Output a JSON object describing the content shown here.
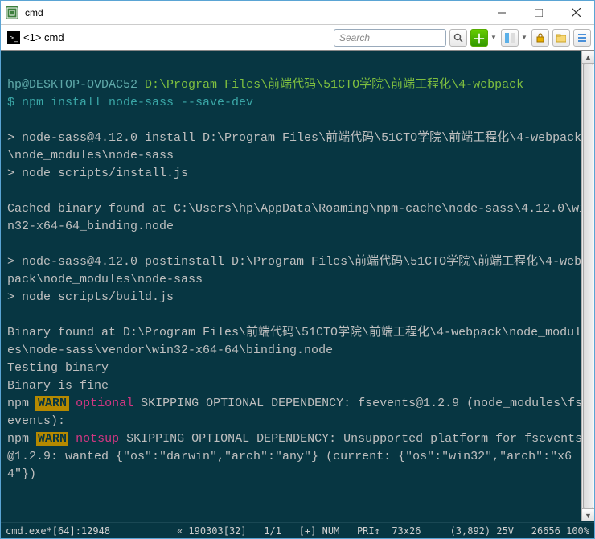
{
  "titlebar": {
    "title": "cmd"
  },
  "tabs": [
    {
      "label": "<1> cmd"
    }
  ],
  "toolbar": {
    "search_placeholder": "Search"
  },
  "terminal": {
    "prompt_user": "hp@DESKTOP-OVDAC52",
    "prompt_path": "D:\\Program Files\\前端代码\\51CTO学院\\前端工程化\\4-webpack",
    "command": "$ npm install node-sass --save-dev",
    "lines": [
      "> node-sass@4.12.0 install D:\\Program Files\\前端代码\\51CTO学院\\前端工程化\\4-webpack\\node_modules\\node-sass",
      "> node scripts/install.js",
      "Cached binary found at C:\\Users\\hp\\AppData\\Roaming\\npm-cache\\node-sass\\4.12.0\\win32-x64-64_binding.node",
      "> node-sass@4.12.0 postinstall D:\\Program Files\\前端代码\\51CTO学院\\前端工程化\\4-webpack\\node_modules\\node-sass",
      "> node scripts/build.js",
      "Binary found at D:\\Program Files\\前端代码\\51CTO学院\\前端工程化\\4-webpack\\node_modules\\node-sass\\vendor\\win32-x64-64\\binding.node",
      "Testing binary",
      "Binary is fine"
    ],
    "warn1": {
      "prefix": "npm",
      "badge": "WARN",
      "kind": "optional",
      "text": "SKIPPING OPTIONAL DEPENDENCY: fsevents@1.2.9 (node_modules\\fsevents):"
    },
    "warn2": {
      "prefix": "npm",
      "badge": "WARN",
      "kind": "notsup",
      "text": "SKIPPING OPTIONAL DEPENDENCY: Unsupported platform for fsevents@1.2.9: wanted {\"os\":\"darwin\",\"arch\":\"any\"} (current: {\"os\":\"win32\",\"arch\":\"x64\"})"
    }
  },
  "status": {
    "exe": "cmd.exe*[64]:12948",
    "build": "« 190303[32]",
    "pos": "1/1",
    "flags": "[+] NUM   PRI↕",
    "size": "73x26",
    "cursor": "(3,892) 25V",
    "sel": "26656",
    "zoom": "100%"
  }
}
